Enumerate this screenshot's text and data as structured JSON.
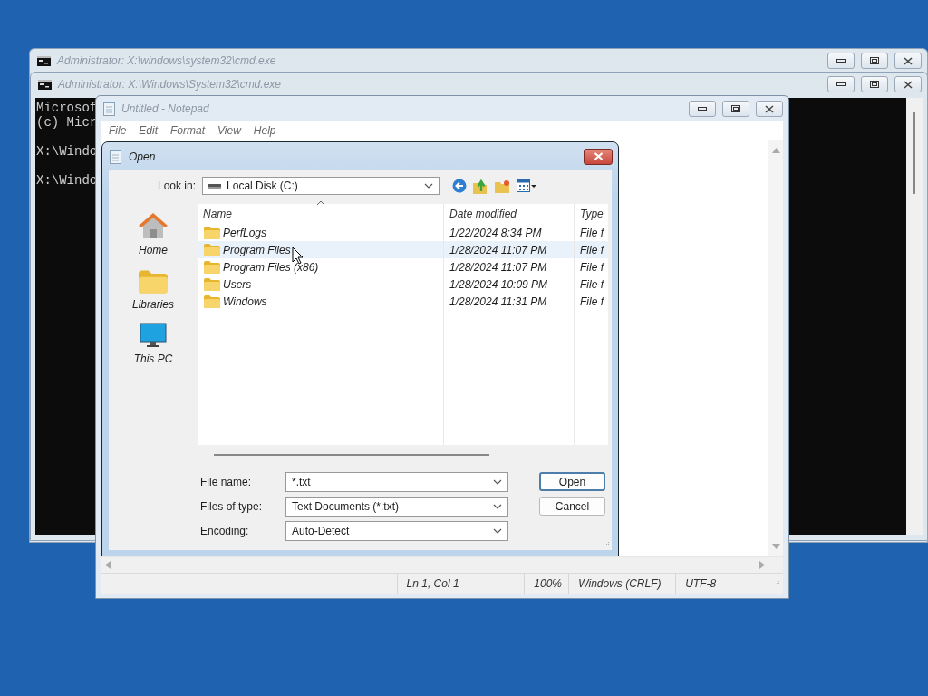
{
  "desktop": {
    "windows": [
      {
        "kind": "console",
        "title": "Administrator: X:\\windows\\system32\\cmd.exe"
      },
      {
        "kind": "console",
        "title": "Administrator: X:\\Windows\\System32\\cmd.exe",
        "paragraphs": [
          [
            "Microsof",
            "(c) Micr"
          ],
          [
            "X:\\Windo"
          ],
          [
            "X:\\Windo"
          ]
        ]
      }
    ]
  },
  "notepad": {
    "title": "Untitled - Notepad",
    "menu": [
      "File",
      "Edit",
      "Format",
      "View",
      "Help"
    ],
    "status_bar": [
      "Ln 1, Col 1",
      "100%",
      "Windows (CRLF)",
      "UTF-8"
    ]
  },
  "open_dialog": {
    "title": "Open",
    "look_in": {
      "label": "Look in:",
      "value": "Local Disk (C:)"
    },
    "places": [
      {
        "label": "Home",
        "kind": "home"
      },
      {
        "label": "Libraries",
        "kind": "libraries"
      },
      {
        "label": "This PC",
        "kind": "pc"
      }
    ],
    "columns": [
      "Name",
      "Date modified",
      "Type"
    ],
    "rows": [
      {
        "name": "PerfLogs",
        "date": "1/22/2024 8:34 PM",
        "type": "File f",
        "hovered": false
      },
      {
        "name": "Program Files",
        "date": "1/28/2024 11:07 PM",
        "type": "File f",
        "hovered": true
      },
      {
        "name": "Program Files (x86)",
        "date": "1/28/2024 11:07 PM",
        "type": "File f",
        "hovered": false
      },
      {
        "name": "Users",
        "date": "1/28/2024 10:09 PM",
        "type": "File f",
        "hovered": false
      },
      {
        "name": "Windows",
        "date": "1/28/2024 11:31 PM",
        "type": "File f",
        "hovered": false
      }
    ],
    "fields": [
      {
        "label": "File name:",
        "value": "*.txt"
      },
      {
        "label": "Files of type:",
        "value": "Text Documents (*.txt)"
      },
      {
        "label": "Encoding:",
        "value": "Auto-Detect"
      }
    ],
    "buttons": [
      {
        "label": "Open",
        "default": true
      },
      {
        "label": "Cancel",
        "default": false
      }
    ]
  }
}
